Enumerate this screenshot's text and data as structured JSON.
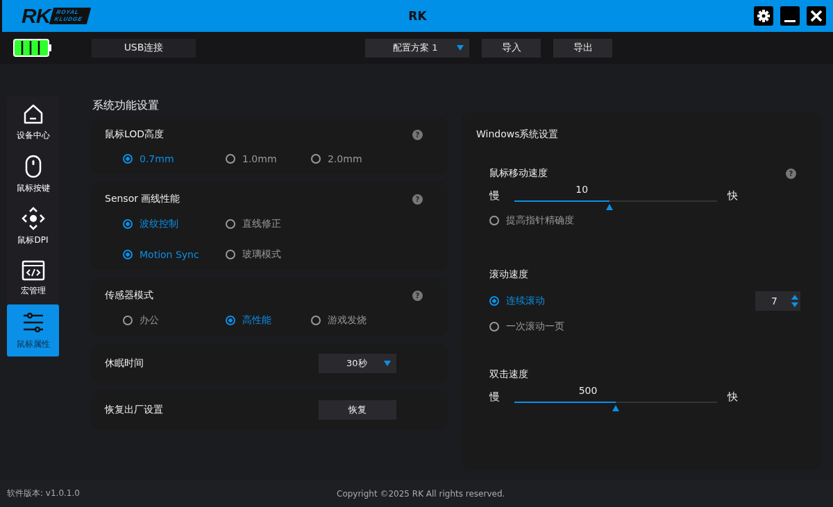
{
  "window": {
    "title": "RK",
    "logo": {
      "mark": "RK",
      "line_1": "ROYAL",
      "line_2": "KLUDGE"
    }
  },
  "toolbar": {
    "connection": "USB连接",
    "profile": "配置方案  1",
    "buttons": [
      "导入",
      "导出"
    ]
  },
  "sidebar": {
    "items": [
      {
        "label": "设备中心",
        "kind": "home",
        "selected": false
      },
      {
        "label": "鼠标按键",
        "kind": "mouse",
        "selected": false
      },
      {
        "label": "鼠标DPI",
        "kind": "dpi",
        "selected": false
      },
      {
        "label": "宏管理",
        "kind": "macro",
        "selected": false
      },
      {
        "label": "鼠标属性",
        "kind": "sliders",
        "selected": true
      }
    ]
  },
  "section_title": "系统功能设置",
  "cards": [
    {
      "kind": "radios",
      "title": "鼠标LOD高度",
      "help": "?",
      "rows": [
        [
          {
            "label": "0.7mm",
            "selected": true
          },
          {
            "label": "1.0mm",
            "selected": false
          },
          {
            "label": "2.0mm",
            "selected": false
          }
        ]
      ]
    },
    {
      "kind": "radios",
      "title": "Sensor 画线性能",
      "help": "?",
      "rows": [
        [
          {
            "label": "波纹控制",
            "selected": true
          },
          {
            "label": "直线修正",
            "selected": false
          }
        ],
        [
          {
            "label": "Motion Sync",
            "selected": true
          },
          {
            "label": "玻璃模式",
            "selected": false
          }
        ]
      ]
    },
    {
      "kind": "radios",
      "title": "传感器模式",
      "help": "?",
      "rows": [
        [
          {
            "label": "办公",
            "selected": false
          },
          {
            "label": "高性能",
            "selected": true
          },
          {
            "label": "游戏发烧",
            "selected": false
          }
        ]
      ]
    },
    {
      "kind": "dropdown",
      "title": "休眠时间",
      "value": "30秒"
    },
    {
      "kind": "button",
      "title": "恢复出厂设置",
      "button": "恢复"
    }
  ],
  "windows_panel": {
    "title": "Windows系统设置",
    "pointer": {
      "title": "鼠标移动速度",
      "help": "?",
      "value": "10",
      "level": 0.47,
      "min_label": "慢",
      "max_label": "快",
      "precision": {
        "label": "提高指针精确度",
        "selected": false
      }
    },
    "scroll": {
      "title": "滚动速度",
      "options": [
        {
          "label": "连续滚动",
          "selected": true
        },
        {
          "label": "一次滚动一页",
          "selected": false
        }
      ],
      "lines": "7"
    },
    "double_click": {
      "title": "双击速度",
      "value": "500",
      "level": 0.5,
      "min_label": "慢",
      "max_label": "快"
    }
  },
  "footer": {
    "version": "软件版本: v1.0.1.0",
    "copyright": "Copyright ©2025 RK All rights reserved."
  }
}
